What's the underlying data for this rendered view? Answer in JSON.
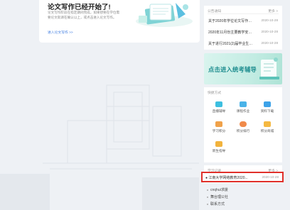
{
  "essay": {
    "title": "论文写作已经开始了!",
    "desc": "论文写作阶段在指定期间完成，如果想要在学位需要论文就请在确认以上，或点击进入论文写作。",
    "link": "进入论文写作 >>"
  },
  "notice": {
    "header": "公告通知",
    "more": "更多 >",
    "items": [
      {
        "title": "关于2020年学位论文写作安排",
        "date": "2020-10-28"
      },
      {
        "title": "2020年11月份主要教学安排通知",
        "date": "2020-10-28"
      },
      {
        "title": "关于进行2021(2)届毕业生工作",
        "date": "2020-10-28"
      }
    ]
  },
  "banner": {
    "text": "点击进入统考辅导"
  },
  "tools": {
    "header": "快捷方式",
    "items": [
      {
        "label": "直播辅导",
        "color": "#3dbfe0"
      },
      {
        "label": "课程作业",
        "color": "#4ab3e8"
      },
      {
        "label": "资料下载",
        "color": "#3da2e8"
      },
      {
        "label": "学习积分",
        "color": "#f0a24a"
      },
      {
        "label": "积分排行",
        "color": "#f08a4a"
      },
      {
        "label": "积分商城",
        "color": "#f5b942"
      },
      {
        "label": "新生指导",
        "color": "#f2b33d"
      }
    ]
  },
  "records": {
    "header": "学习记录",
    "more": "更多 >",
    "item": {
      "title": "● 江南大学网络教育2020...",
      "date": "2020-10-28"
    }
  },
  "footer_links": [
    "cnqhui求援",
    "舞台理公社",
    "联系方式"
  ]
}
